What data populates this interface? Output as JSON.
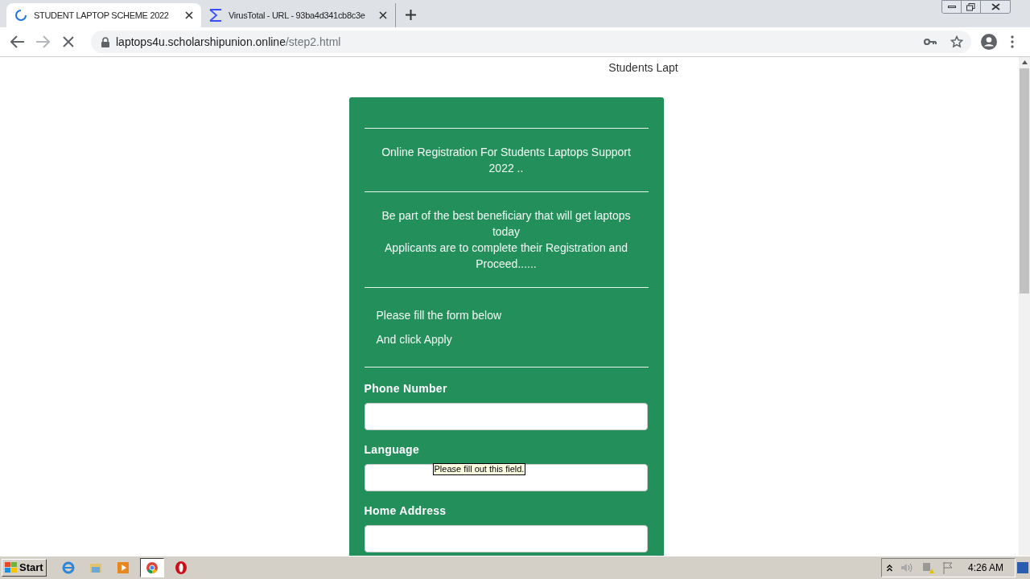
{
  "tabs": [
    {
      "title": "STUDENT LAPTOP SCHEME 2022",
      "kind": "loading",
      "selected": true
    },
    {
      "title": "VirusTotal - URL - 93ba4d341cb8c3e",
      "kind": "sigma",
      "selected": false
    }
  ],
  "address_bar": {
    "host": "laptops4u.scholarshipunion.online",
    "path": "/step2.html"
  },
  "page": {
    "header": "Students Lapt",
    "sections": [
      {
        "kind": "centered",
        "lines": [
          "Online Registration For Students Laptops Support 2022 .."
        ]
      },
      {
        "kind": "centered",
        "lines": [
          "Be part of the best beneficiary that will get laptops today",
          "Applicants are to complete their Registration and Proceed......"
        ]
      },
      {
        "kind": "list",
        "lines": [
          "Please fill the form below",
          "And click Apply"
        ]
      }
    ],
    "fields": [
      {
        "label": "Phone Number"
      },
      {
        "label": "Language",
        "tooltip": "Please fill out this field."
      },
      {
        "label": "Home Address"
      }
    ]
  },
  "taskbar": {
    "start": "Start",
    "apps": [
      {
        "kind": "ie",
        "selected": false
      },
      {
        "kind": "folder",
        "selected": false
      },
      {
        "kind": "media",
        "selected": false
      },
      {
        "kind": "chrome",
        "selected": true
      },
      {
        "kind": "opera",
        "selected": false
      }
    ],
    "clock": "4:26 AM"
  }
}
